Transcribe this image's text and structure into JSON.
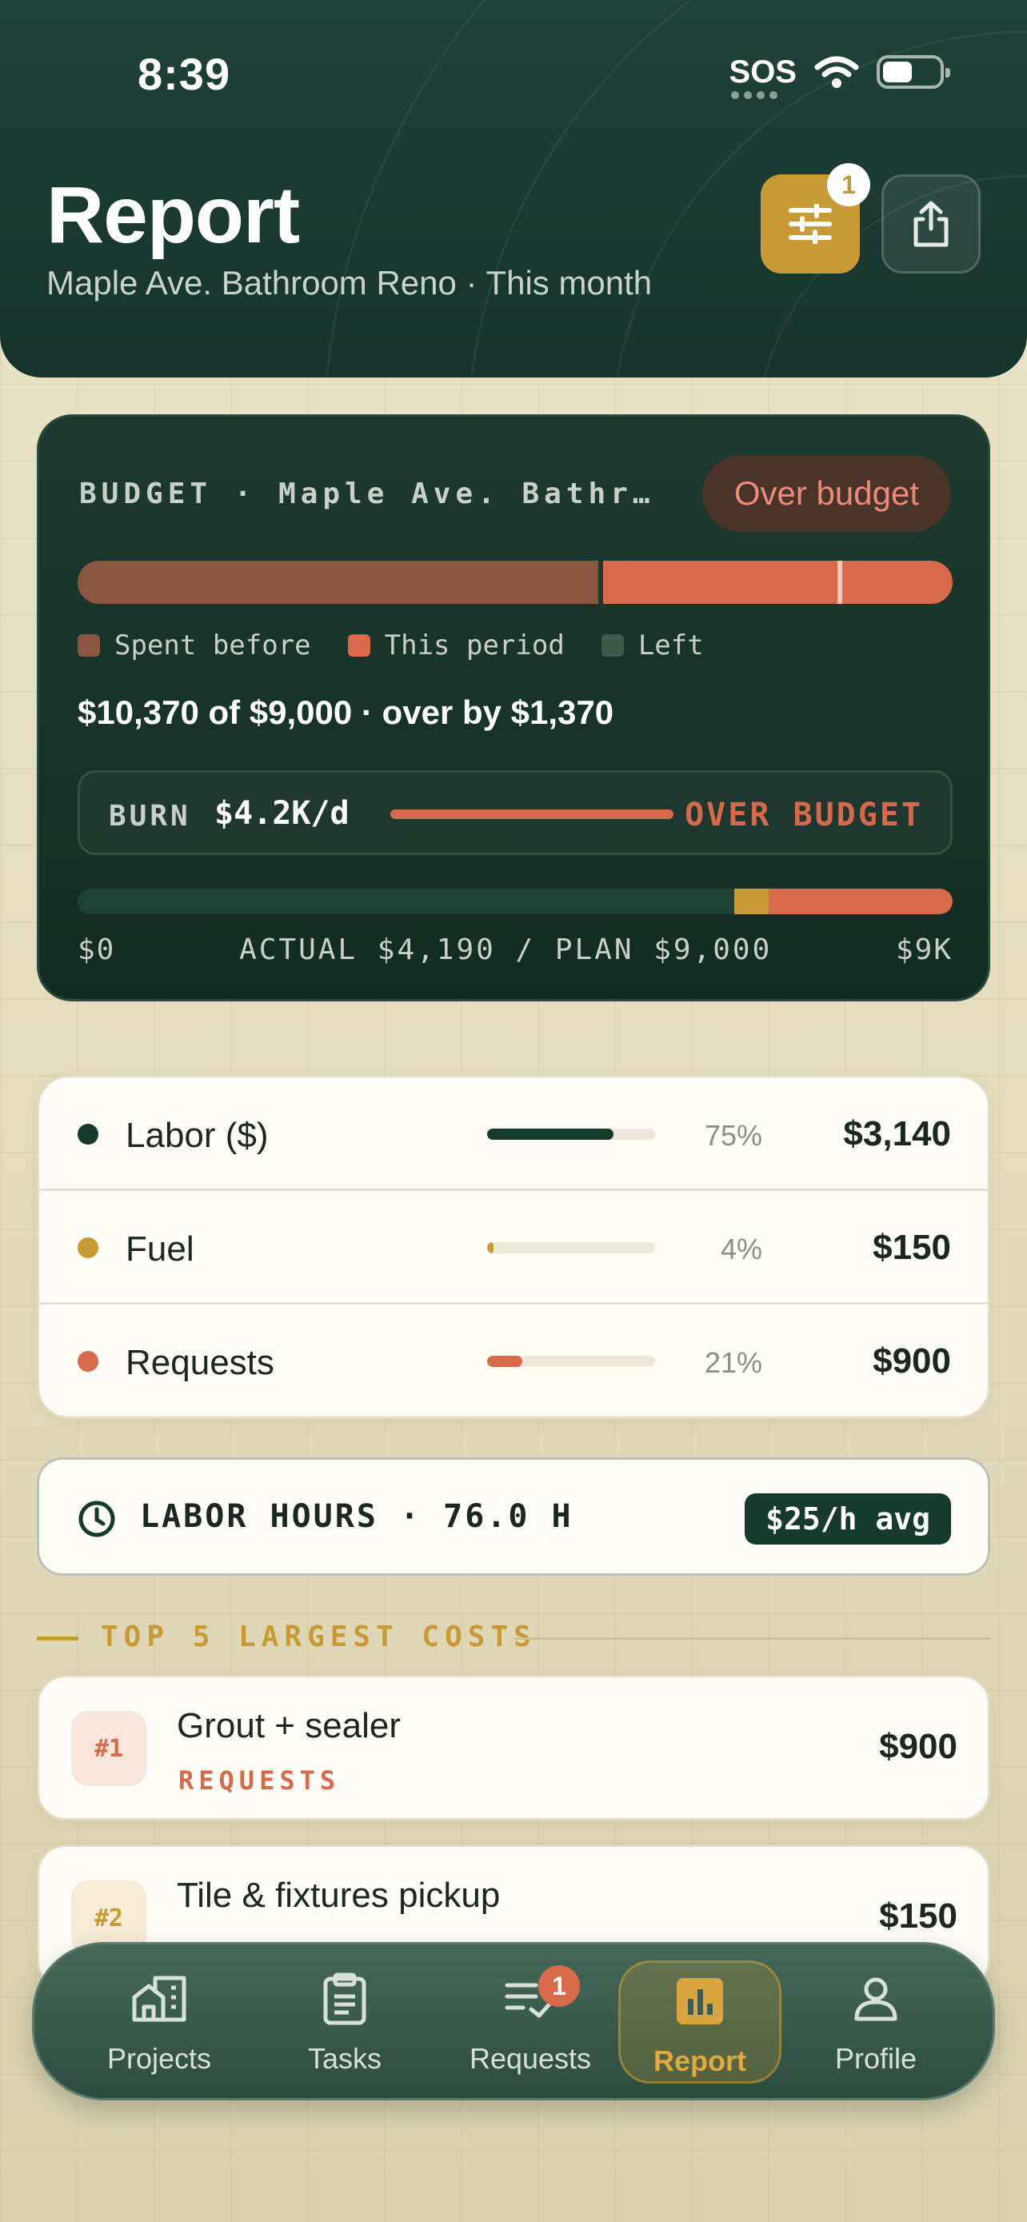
{
  "status_bar": {
    "time": "8:39",
    "sos": "SOS"
  },
  "header": {
    "title": "Report",
    "subtitle": "Maple Ave. Bathroom Reno · This month",
    "filter_badge": "1"
  },
  "budget": {
    "label": "BUDGET · Maple Ave. Bathr…",
    "status_pill": "Over budget",
    "legend": [
      "Spent before",
      "This period",
      "Left"
    ],
    "summary": "$10,370 of $9,000 · over by $1,370",
    "spent_before_fraction": 0.595,
    "this_period_fraction": 0.405,
    "plan_marker_fraction": 0.868,
    "burn": {
      "label": "BURN",
      "value": "$4.2K/d",
      "status": "OVER BUDGET"
    },
    "plan_bar": {
      "actual_fraction": 0.75,
      "gold_fraction": 0.04
    },
    "axis": {
      "min": "$0",
      "middle": "ACTUAL $4,190 / PLAN $9,000",
      "max": "$9K"
    },
    "colors": {
      "spent_before": "#8a5640",
      "this_period": "#d76a4b",
      "left": "#3d5a4c"
    }
  },
  "categories": [
    {
      "name": "Labor ($)",
      "pct": "75%",
      "fraction": 0.75,
      "amount": "$3,140",
      "color": "#173a2f"
    },
    {
      "name": "Fuel",
      "pct": "4%",
      "fraction": 0.04,
      "amount": "$150",
      "color": "#c89a36"
    },
    {
      "name": "Requests",
      "pct": "21%",
      "fraction": 0.21,
      "amount": "$900",
      "color": "#d76a4b"
    }
  ],
  "labor_hours": {
    "label": "LABOR HOURS · 76.0 H",
    "rate": "$25/h avg"
  },
  "top_costs": {
    "heading": "TOP 5 LARGEST COSTS",
    "items": [
      {
        "rank": "#1",
        "name": "Grout + sealer",
        "category": "REQUESTS",
        "amount": "$900"
      },
      {
        "rank": "#2",
        "name": "Tile & fixtures pickup",
        "category": "",
        "amount": "$150"
      }
    ]
  },
  "tabs": [
    {
      "label": "Projects",
      "icon": "building-icon"
    },
    {
      "label": "Tasks",
      "icon": "clipboard-icon"
    },
    {
      "label": "Requests",
      "icon": "list-check-icon",
      "badge": "1"
    },
    {
      "label": "Report",
      "icon": "bar-chart-icon",
      "active": true
    },
    {
      "label": "Profile",
      "icon": "person-icon"
    }
  ]
}
